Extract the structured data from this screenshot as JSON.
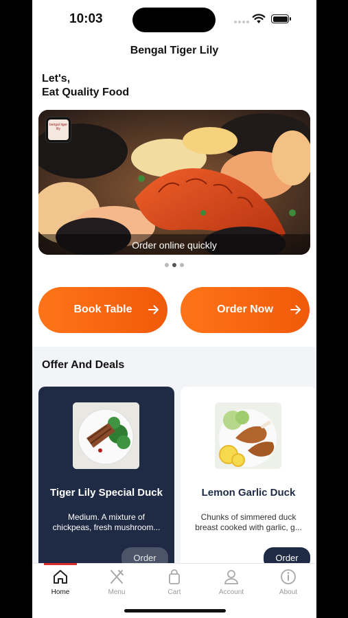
{
  "status_bar": {
    "time": "10:03"
  },
  "header": {
    "title": "Bengal Tiger Lily"
  },
  "greeting": {
    "line1": "Let's,",
    "line2": "Eat Quality Food"
  },
  "banner": {
    "caption": "Order online quickly",
    "logo_text": "bengal tiger lily",
    "slides": 3,
    "active_slide": 2
  },
  "actions": {
    "book_table": "Book Table",
    "order_now": "Order Now"
  },
  "offers": {
    "title": "Offer And Deals",
    "items": [
      {
        "name": "Tiger Lily Special Duck",
        "desc_line1": "Medium. A mixture of",
        "desc_line2": "chickpeas, fresh mushroom...",
        "button": "Order"
      },
      {
        "name": "Lemon Garlic Duck",
        "desc_line1": "Chunks of simmered duck",
        "desc_line2": "breast cooked with garlic, g...",
        "button": "Order"
      }
    ]
  },
  "tabbar": {
    "items": [
      {
        "label": "Home",
        "icon": "home-icon"
      },
      {
        "label": "Menu",
        "icon": "fork-knife-icon"
      },
      {
        "label": "Cart",
        "icon": "shopping-bag-icon"
      },
      {
        "label": "Account",
        "icon": "user-icon"
      },
      {
        "label": "About",
        "icon": "info-icon"
      }
    ],
    "active": "Home"
  },
  "colors": {
    "accent_orange": "#f26a0f",
    "navy": "#1f2a44",
    "active_indicator": "#e02c2c"
  }
}
